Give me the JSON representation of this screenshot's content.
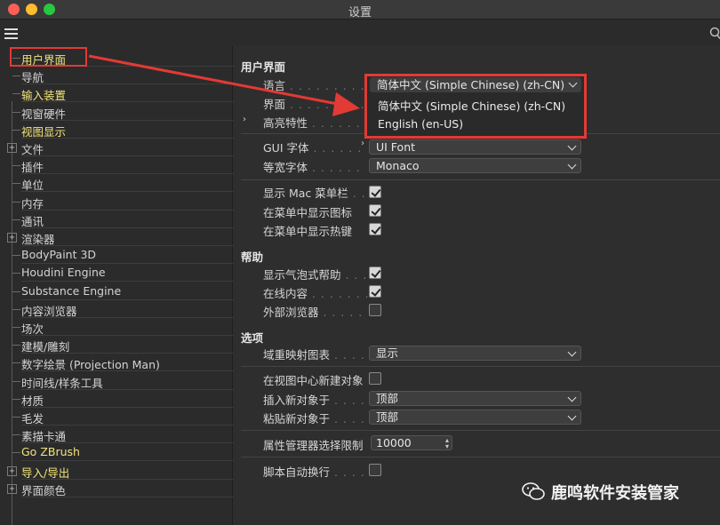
{
  "window": {
    "title": "设置"
  },
  "sidebar": {
    "items": [
      {
        "label": "用户界面",
        "highlight": true,
        "expand": ""
      },
      {
        "label": "导航",
        "highlight": false,
        "expand": ""
      },
      {
        "label": "输入装置",
        "highlight": true,
        "expand": ""
      },
      {
        "label": "视窗硬件",
        "highlight": false,
        "expand": ""
      },
      {
        "label": "视图显示",
        "highlight": true,
        "expand": ""
      },
      {
        "label": "文件",
        "highlight": false,
        "expand": "+"
      },
      {
        "label": "插件",
        "highlight": false,
        "expand": ""
      },
      {
        "label": "单位",
        "highlight": false,
        "expand": ""
      },
      {
        "label": "内存",
        "highlight": false,
        "expand": ""
      },
      {
        "label": "通讯",
        "highlight": false,
        "expand": ""
      },
      {
        "label": "渲染器",
        "highlight": false,
        "expand": "+"
      },
      {
        "label": "BodyPaint 3D",
        "highlight": false,
        "expand": ""
      },
      {
        "label": "Houdini Engine",
        "highlight": false,
        "expand": ""
      },
      {
        "label": "Substance Engine",
        "highlight": false,
        "expand": ""
      },
      {
        "label": "内容浏览器",
        "highlight": false,
        "expand": ""
      },
      {
        "label": "场次",
        "highlight": false,
        "expand": ""
      },
      {
        "label": "建模/雕刻",
        "highlight": false,
        "expand": ""
      },
      {
        "label": "数字绘景 (Projection Man)",
        "highlight": false,
        "expand": ""
      },
      {
        "label": "时间线/样条工具",
        "highlight": false,
        "expand": ""
      },
      {
        "label": "材质",
        "highlight": false,
        "expand": ""
      },
      {
        "label": "毛发",
        "highlight": false,
        "expand": ""
      },
      {
        "label": "素描卡通",
        "highlight": false,
        "expand": ""
      },
      {
        "label": "Go ZBrush",
        "highlight": true,
        "expand": ""
      },
      {
        "label": "导入/导出",
        "highlight": true,
        "expand": "+"
      },
      {
        "label": "界面颜色",
        "highlight": false,
        "expand": "+"
      }
    ]
  },
  "main": {
    "section_ui": "用户界面",
    "language_label": "语言",
    "language_value": "简体中文 (Simple Chinese) (zh-CN)",
    "language_options": [
      "简体中文 (Simple Chinese) (zh-CN)",
      "English (en-US)"
    ],
    "interface_label": "界面",
    "highlight_label": "高亮特性",
    "gui_font_label": "GUI 字体",
    "gui_font_value": "UI Font",
    "mono_font_label": "等宽字体",
    "mono_font_value": "Monaco",
    "show_mac_menu_label": "显示 Mac 菜单栏",
    "show_menu_icons_label": "在菜单中显示图标",
    "show_menu_hotkeys_label": "在菜单中显示热键",
    "section_help": "帮助",
    "bubble_help_label": "显示气泡式帮助",
    "online_content_label": "在线内容",
    "external_browser_label": "外部浏览器",
    "section_options": "选项",
    "remap_label": "域重映射图表",
    "remap_value": "显示",
    "create_center_label": "在视图中心新建对象",
    "insert_new_label": "插入新对象于",
    "insert_new_value": "顶部",
    "paste_new_label": "粘贴新对象于",
    "paste_new_value": "顶部",
    "attr_limit_label": "属性管理器选择限制",
    "attr_limit_value": "10000",
    "script_wrap_label": "脚本自动换行"
  },
  "watermark": {
    "text": "鹿鸣软件安装管家"
  },
  "colors": {
    "highlight_text": "#f1e47a",
    "annotation_red": "#e23a35"
  }
}
